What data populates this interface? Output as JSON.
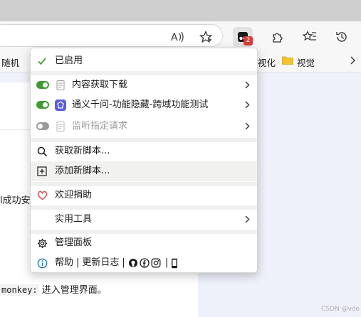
{
  "colors": {
    "accent_green": "#3f9c35",
    "toggle_off": "#9a9a9a",
    "badge_red": "#d83b3b",
    "heart_red": "#d9534f",
    "info_blue": "#1a73a8",
    "script_icon_purple": "#5b5ce2",
    "folder_yellow": "#f1c232"
  },
  "browser": {
    "toolbar_icons": [
      "read-aloud-icon",
      "favorite-star-icon",
      "tampermonkey-extension-icon",
      "extensions-puzzle-icon",
      "favorites-list-icon",
      "history-icon"
    ],
    "extension_badge": "2",
    "bookmarks": {
      "left_item": "随机",
      "middle_item_partial": "视化",
      "folder_item": "视觉"
    }
  },
  "page": {
    "text_partial": "l成功安",
    "code_mono": "monkey:",
    "code_text": " 进入管理界面。",
    "watermark": "CSDN @vdo"
  },
  "menu": {
    "enabled_label": "已启用",
    "scripts": [
      {
        "label": "内容获取下载",
        "enabled": true,
        "has_submenu": true
      },
      {
        "label": "通义千问-功能隐藏-跨域功能测试",
        "enabled": true,
        "has_submenu": true
      },
      {
        "label": "监听指定请求",
        "enabled": false,
        "has_submenu": true
      }
    ],
    "get_new_script": "获取新脚本...",
    "add_new_script": "添加新脚本...",
    "donate": "欢迎捐助",
    "utilities": "实用工具",
    "dashboard": "管理面板",
    "help": "帮助",
    "changelog": "更新日志",
    "social_icons": [
      "github-icon",
      "facebook-icon",
      "instagram-icon",
      "mobile-icon"
    ]
  }
}
